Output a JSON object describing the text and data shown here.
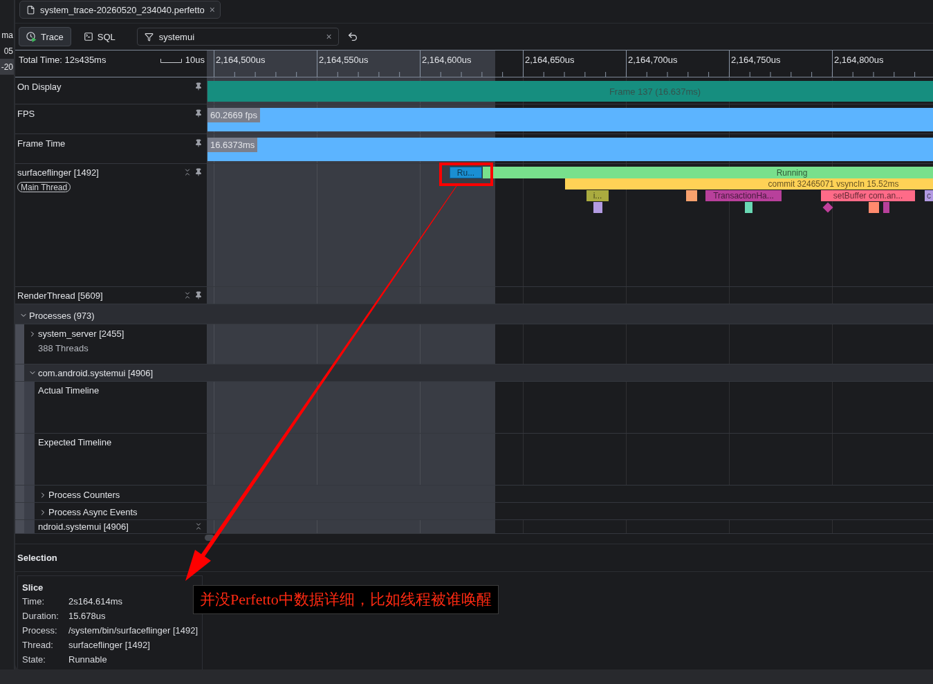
{
  "side_strip": [
    {
      "label": "ma",
      "selected": false
    },
    {
      "label": "05",
      "selected": false
    },
    {
      "label": "-20",
      "selected": true
    }
  ],
  "file_tab": {
    "title": "system_trace-20260520_234040.perfetto",
    "close": "×"
  },
  "toolbar": {
    "modes": [
      {
        "label": "Trace",
        "kind": "trace",
        "selected": true
      },
      {
        "label": "SQL",
        "kind": "sql",
        "selected": false
      }
    ],
    "filter": {
      "value": "systemui",
      "clear": "×"
    }
  },
  "ruler": {
    "total_time": "Total Time: 12s435ms",
    "scale": "10us",
    "labels": [
      "2,164,500us",
      "2,164,550us",
      "2,164,600us",
      "2,164,650us",
      "2,164,700us",
      "2,164,750us",
      "2,164,800us"
    ]
  },
  "pinned_tracks": [
    {
      "kind": "frames",
      "title": "On Display",
      "bar": {
        "label": "Frame 137 (16.637ms)",
        "color": "#168e7f"
      }
    },
    {
      "kind": "counter",
      "title": "FPS",
      "bar": {
        "label": "60.2669 fps",
        "color": "#5cb4ff"
      }
    },
    {
      "kind": "counter",
      "title": "Frame Time",
      "bar": {
        "label": "16.6373ms",
        "color": "#5cb4ff"
      }
    },
    {
      "kind": "thread",
      "title": "surfaceflinger [1492]",
      "chip": "Main Thread",
      "lanes": [
        {
          "slices": [
            {
              "label": "Ru...",
              "color": "#1a8fd2",
              "kind": "slice",
              "selected": true
            },
            {
              "label": "Running",
              "color": "#78e08c",
              "kind": "slice",
              "selected": false
            }
          ]
        },
        {
          "slices": [
            {
              "label": "commit 32465071 vsyncIn 15.52ms",
              "color": "#ffd256",
              "kind": "slice",
              "selected": false
            }
          ]
        },
        {
          "slices": [
            {
              "label": "i...",
              "color": "#aaab3f",
              "kind": "slice",
              "selected": false
            },
            {
              "color": "#f7a16d",
              "kind": "slice",
              "selected": false
            },
            {
              "label": "TransactionHa...",
              "color": "#b8409b",
              "kind": "slice",
              "selected": false
            },
            {
              "label": "setBuffer com.an...",
              "color": "#ff6b88",
              "kind": "slice",
              "selected": false
            },
            {
              "label": "c",
              "color": "#b29ae2",
              "kind": "slice",
              "selected": false
            }
          ]
        },
        {
          "slices": [
            {
              "color": "#b39be2",
              "kind": "slice",
              "selected": false
            },
            {
              "color": "#6ad8b4",
              "kind": "slice",
              "selected": false
            },
            {
              "color": "#c03f9b",
              "kind": "instant",
              "selected": false
            },
            {
              "color": "#ff8a6e",
              "kind": "slice",
              "selected": false
            },
            {
              "color": "#b8409b",
              "kind": "slice",
              "selected": false
            }
          ]
        }
      ]
    },
    {
      "kind": "thread",
      "title": "RenderThread [5609]"
    }
  ],
  "processes": {
    "title": "Processes (973)",
    "expanded": true,
    "children": [
      {
        "kind": "group",
        "title": "system_server [2455]",
        "subtitle": "388 Threads",
        "expanded": false
      },
      {
        "kind": "group",
        "title": "com.android.systemui [4906]",
        "expanded": true,
        "children": [
          {
            "kind": "track",
            "title": "Actual Timeline"
          },
          {
            "kind": "track",
            "title": "Expected Timeline"
          },
          {
            "kind": "group",
            "title": "Process Counters",
            "expanded": false
          },
          {
            "kind": "group",
            "title": "Process Async Events",
            "expanded": false
          },
          {
            "kind": "thread",
            "title": "ndroid.systemui [4906]"
          }
        ]
      }
    ]
  },
  "selection": {
    "title": "Selection",
    "details": {
      "heading": "Slice",
      "rows": [
        {
          "key": "Time:",
          "value": "2s164.614ms"
        },
        {
          "key": "Duration:",
          "value": "15.678us"
        },
        {
          "key": "Process:",
          "value": "/system/bin/surfaceflinger [1492]"
        },
        {
          "key": "Thread:",
          "value": "surfaceflinger [1492]"
        },
        {
          "key": "State:",
          "value": "Runnable"
        }
      ]
    }
  },
  "annotation": {
    "note": "并没Perfetto中数据详细，比如线程被谁唤醒"
  }
}
